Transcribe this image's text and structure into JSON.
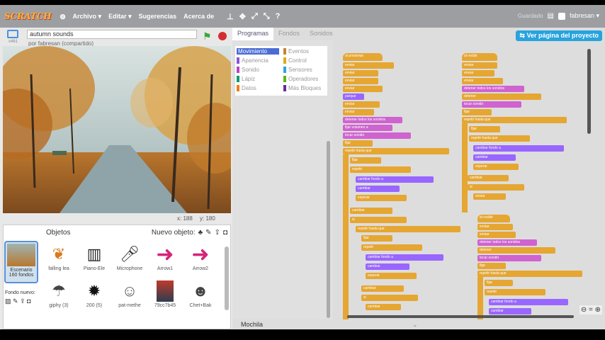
{
  "menubar": {
    "logo": "SCRATCH",
    "items": [
      "Archivo ▾",
      "Editar ▾",
      "Sugerencias",
      "Acerca de"
    ],
    "user_status": "Guardado",
    "username": "fabresan ▾"
  },
  "project": {
    "title": "autumn sounds",
    "by": "por fabresan (compartido)",
    "version": "v461"
  },
  "stage": {
    "coords_x": "x: 188",
    "coords_y": "y: 180"
  },
  "sprites": {
    "header": "Objetos",
    "new_sprite": "Nuevo objeto:",
    "stage_label": "Escenario",
    "stage_count": "160 fondos",
    "new_backdrop": "Fondo nuevo:",
    "items": [
      {
        "label": "falling lea"
      },
      {
        "label": "Piano-Ele"
      },
      {
        "label": "Microphone"
      },
      {
        "label": "Arrow1"
      },
      {
        "label": "Arrow2"
      },
      {
        "label": "giphy (3)"
      },
      {
        "label": "200 (5)"
      },
      {
        "label": "pat-methe"
      },
      {
        "label": "79cc7b45"
      },
      {
        "label": "Chet+Bak"
      }
    ]
  },
  "palette": {
    "tabs": [
      "Programas",
      "Fondos",
      "Sonidos"
    ],
    "categories": [
      {
        "label": "Movimiento",
        "color": "#4a6cd4"
      },
      {
        "label": "Eventos",
        "color": "#c88330"
      },
      {
        "label": "Apariencia",
        "color": "#8a55d7"
      },
      {
        "label": "Control",
        "color": "#e1a91a"
      },
      {
        "label": "Sonido",
        "color": "#bb42c3"
      },
      {
        "label": "Sensores",
        "color": "#2ca5e2"
      },
      {
        "label": "Lápiz",
        "color": "#0e9a6c"
      },
      {
        "label": "Operadores",
        "color": "#5cb712"
      },
      {
        "label": "Datos",
        "color": "#ee7d16"
      },
      {
        "label": "Más Bloques",
        "color": "#632d99"
      }
    ]
  },
  "scripts": {
    "see_project": "Ver página del proyecto",
    "backpack": "Mochila",
    "blocks_left": [
      "al presionar",
      "enviar",
      "enviar",
      "enviar",
      "enviar",
      "parque",
      "enviar",
      "enviar",
      "detener todos los sonidos",
      "fijar volumen a",
      "tocar sonido",
      "fijar",
      "repetir hasta que",
      "fijar",
      "repetir",
      "cambiar fondo a",
      "cambiar",
      "esperar",
      "cambiar",
      "si",
      "repetir hasta que",
      "fijar",
      "repetir",
      "cambiar fondo a",
      "cambiar",
      "esperar",
      "cambiar",
      "si",
      "cambiar"
    ],
    "blocks_right": [
      "al recibir",
      "enviar",
      "enviar",
      "enviar",
      "detener todos los sonidos",
      "detener",
      "tocar sonido",
      "fijar",
      "repetir hasta que",
      "fijar",
      "repetir hasta que",
      "cambiar fondo a",
      "cambiar",
      "esperar",
      "cambiar",
      "si",
      "enviar",
      "al recibir",
      "enviar",
      "enviar",
      "detener todos los sonidos",
      "detener",
      "tocar sonido",
      "fijar",
      "repetir hasta que",
      "fijar",
      "repetir",
      "cambiar fondo a",
      "cambiar"
    ]
  }
}
